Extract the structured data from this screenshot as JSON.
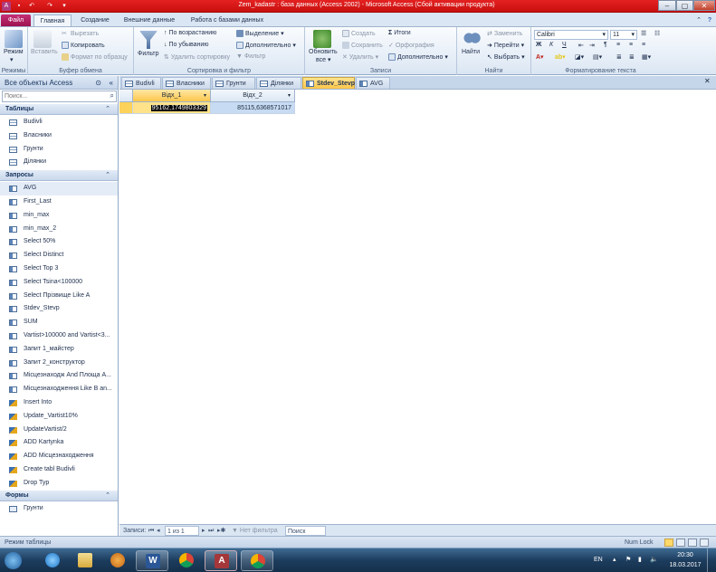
{
  "window": {
    "title": "Zem_kadastr : база данных (Access 2002) - Microsoft Access (Сбой активации продукта)",
    "controls": [
      "–",
      "▢",
      "✕"
    ]
  },
  "ribbon_tabs": [
    "Файл",
    "Главная",
    "Создание",
    "Внешние данные",
    "Работа с базами данных"
  ],
  "ribbon": {
    "view": {
      "label": "Режим",
      "group": "Режимы"
    },
    "clipboard": {
      "paste": "Вставить",
      "cut": "Вырезать",
      "copy": "Копировать",
      "format": "Формат по образцу",
      "group": "Буфер обмена"
    },
    "sort": {
      "filter": "Фильтр",
      "asc": "По возрастанию",
      "desc": "По убыванию",
      "clear": "Удалить сортировку",
      "selection": "Выделение",
      "advanced": "Дополнительно",
      "toggle": "Фильтр",
      "group": "Сортировка и фильтр"
    },
    "records": {
      "refresh": "Обновить",
      "refresh2": "все",
      "new": "Создать",
      "save": "Сохранить",
      "delete": "Удалить",
      "totals": "Итоги",
      "spelling": "Орфография",
      "more": "Дополнительно",
      "group": "Записи"
    },
    "find": {
      "find": "Найти",
      "replace": "Заменить",
      "goto": "Перейти",
      "select": "Выбрать",
      "group": "Найти"
    },
    "text": {
      "font": "Calibri",
      "size": "11",
      "bold": "Ж",
      "italic": "К",
      "underline": "Ч",
      "group": "Форматирование текста"
    }
  },
  "nav": {
    "title": "Все объекты Access",
    "search_placeholder": "Поиск...",
    "tables_header": "Таблицы",
    "tables": [
      "Budivli",
      "Власники",
      "Грунти",
      "Ділянки"
    ],
    "queries_header": "Запросы",
    "queries": [
      "AVG",
      "First_Last",
      "min_max",
      "min_max_2",
      "Select 50%",
      "Select Distinct",
      "Select Top 3",
      "Select Tsina<100000",
      "Select Прізвище Like A",
      "Stdev_Stevp",
      "SUM",
      "Vartist>100000 and Vartist<3...",
      "Запит 1_майстер",
      "Запит 2_конструктор",
      "Місцезнаходж And Площа A...",
      "Місцезнаходження Like B an...",
      "Insert Into",
      "Update_Vartist10%",
      "UpdateVartist/2",
      "ADD Kartynka",
      "ADD Місцезнаходження",
      "Create tabl Budivli",
      "Drop Typ"
    ],
    "forms_header": "Формы",
    "forms": [
      "Грунти"
    ]
  },
  "doc_tabs": [
    "Budivli",
    "Власники",
    "Грунти",
    "Ділянки",
    "Stdev_Stevp",
    "AVG"
  ],
  "active_tab": "Stdev_Stevp",
  "datasheet": {
    "columns": [
      "Відх_1",
      "Відх_2"
    ],
    "row": [
      "95162,1749803329",
      "85115,6368571017"
    ]
  },
  "record_nav": {
    "label": "Записи:",
    "position": "1 из 1",
    "filter": "Нет фильтра",
    "search": "Поиск"
  },
  "status": {
    "mode": "Режим таблицы",
    "numlock": "Num Lock"
  },
  "taskbar": {
    "lang": "EN",
    "time": "20:30",
    "date": "18.03.2017"
  },
  "colors": {
    "title_bar": "#d91b1b",
    "file_tab": "#b0215f",
    "active_tab": "#fcc64a",
    "selected_cell": "#ffd24d"
  }
}
